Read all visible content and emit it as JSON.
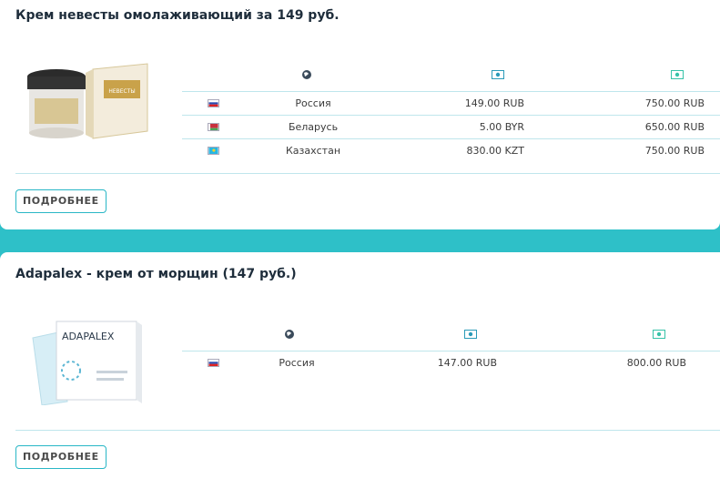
{
  "products": [
    {
      "title": "Крем невесты омолаживающий за 149 руб.",
      "image_text": {
        "brand": "НЕВЕСТЫ"
      },
      "rows": [
        {
          "country": "Россия",
          "flag": "ru",
          "price": "149.00 RUB",
          "old_price": "750.00 RUB"
        },
        {
          "country": "Беларусь",
          "flag": "by",
          "price": "5.00 BYR",
          "old_price": "650.00 RUB"
        },
        {
          "country": "Казахстан",
          "flag": "kz",
          "price": "830.00 KZT",
          "old_price": "750.00 RUB"
        }
      ],
      "button": "ПОДРОБНЕЕ"
    },
    {
      "title": "Adapalex - крем от морщин (147 руб.)",
      "image_text": {
        "brand": "ADAPALEX"
      },
      "rows": [
        {
          "country": "Россия",
          "flag": "ru",
          "price": "147.00 RUB",
          "old_price": "800.00 RUB"
        }
      ],
      "button": "ПОДРОБНЕЕ"
    }
  ],
  "icons": {
    "country_col": "globe-icon",
    "price_col": "money-icon",
    "old_price_col": "money-icon"
  },
  "colors": {
    "accent": "#29b7c6",
    "background_top": "#1fb5c8",
    "background_bottom": "#36c2bf",
    "title": "#1e2d3b"
  }
}
